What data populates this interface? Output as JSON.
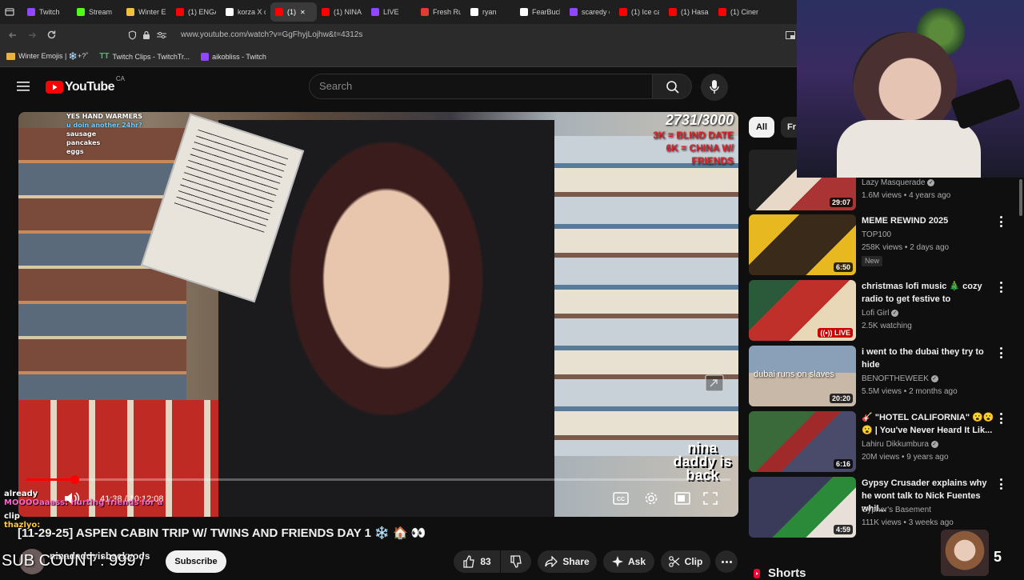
{
  "browser": {
    "tabs": [
      {
        "label": "Twitch",
        "color": "#9146ff"
      },
      {
        "label": "Stream",
        "color": "#53fc18"
      },
      {
        "label": "Winter Er",
        "color": "#f0c040"
      },
      {
        "label": "(1) ENGA",
        "color": "#ff0000"
      },
      {
        "label": "korza X c",
        "color": "#ffffff"
      },
      {
        "label": "(1)",
        "color": "#ff0000"
      },
      {
        "label": "(1) NINA",
        "color": "#ff0000"
      },
      {
        "label": "LIVE",
        "color": "#9146ff"
      },
      {
        "label": "Fresh Ru",
        "color": "#e53935"
      },
      {
        "label": "ryan",
        "color": "#ffffff"
      },
      {
        "label": "FearBuck",
        "color": "#ffffff"
      },
      {
        "label": "scaredy c",
        "color": "#9146ff"
      },
      {
        "label": "(1) Ice car",
        "color": "#ff0000"
      },
      {
        "label": "(1) Hasan",
        "color": "#ff0000"
      },
      {
        "label": "(1) Cinem",
        "color": "#ff0000"
      }
    ],
    "url": "www.youtube.com/watch?v=GgFhyjLojhw&t=4312s",
    "bookmarks": [
      {
        "label": "Winter Emojis | ❄️+?˚"
      },
      {
        "label": "Twitch Clips - TwitchTr..."
      },
      {
        "label": "aikobliss - Twitch"
      }
    ]
  },
  "youtube": {
    "logo_text": "YouTube",
    "region": "CA",
    "search_placeholder": "Search"
  },
  "video": {
    "overlay_counter": "2731/3000",
    "overlay_goal_1": "3K = BLIND DATE",
    "overlay_goal_2": "6K = CHINA W/",
    "overlay_goal_3": "FRIENDS",
    "overlay_chat": [
      "YES HAND WARMERS",
      "u doin another 24hr?",
      "sausage",
      "pancakes",
      "eggs"
    ],
    "time_current": "41:38",
    "time_total": "10:12:08",
    "progress_fraction": 0.068,
    "brand_overlay": "nina daddy is back",
    "title": "[11-29-25] ASPEN CABIN TRIP W/ TWINS AND FRIENDS DAY 1 ❄️ 🏠 👀",
    "channel": "ninadaddyisbackyods",
    "subscribe_label": "Subscribe",
    "like_count": "83",
    "share_label": "Share",
    "ask_label": "Ask",
    "clip_label": "Clip"
  },
  "stream_overlay": {
    "chat_line_1_name": "already",
    "chat_line_2": "MOOOOaaass: hurting friends for a",
    "chat_line_3": "clip",
    "chat_line_4": "thazlyo:",
    "sub_count": "SUB COUNT : 999 /",
    "corner_number": "5"
  },
  "sidebar": {
    "chips": [
      "All",
      "Fr"
    ],
    "items": [
      {
        "title": "",
        "channel": "Lazy Masquerade",
        "verified": true,
        "meta": "1.6M views • 4 years ago",
        "duration": "29:07",
        "badge": ""
      },
      {
        "title": "MEME REWIND 2025",
        "channel": "TOP100",
        "verified": false,
        "meta": "258K views • 2 days ago",
        "duration": "6:50",
        "badge": "New"
      },
      {
        "title": "christmas lofi music 🎄 cozy radio to get festive to",
        "channel": "Lofi Girl",
        "verified": true,
        "meta": "2.5K watching",
        "duration": "LIVE",
        "badge": ""
      },
      {
        "title": "i went to the dubai they try to hide",
        "channel": "BENOFTHEWEEK",
        "verified": true,
        "meta": "5.5M views • 2 months ago",
        "duration": "20:20",
        "badge": "",
        "thumb_text": "dubai runs on slaves"
      },
      {
        "title": "🎸 \"HOTEL CALIFORNIA\" 😮😮 😮 | You've Never Heard It Lik...",
        "channel": "Lahiru Dikkumbura",
        "verified": true,
        "meta": "20M views • 9 years ago",
        "duration": "6:16",
        "badge": ""
      },
      {
        "title": "Gypsy Crusader explains why he wont talk to Nick Fuentes whil...",
        "channel": "Cypher's Basement",
        "verified": false,
        "meta": "111K views • 3 weeks ago",
        "duration": "4:59",
        "badge": ""
      }
    ],
    "shorts_label": "Shorts"
  }
}
